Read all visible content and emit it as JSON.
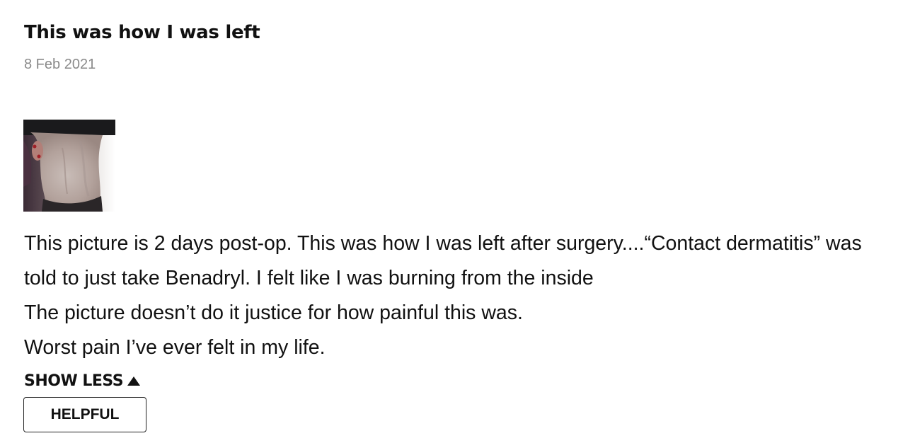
{
  "review": {
    "title": "This was how I was left",
    "date": "8 Feb 2021",
    "body_lines": [
      "This picture is 2 days post-op. This was how I was left after surgery....“Contact dermatitis” was",
      "told to just take Benadryl. I felt like I was burning from the inside",
      "The picture doesn’t do it justice for how painful this was.",
      "Worst pain I’ve ever felt in my life."
    ],
    "show_less_label": "SHOW LESS",
    "helpful_label": "HELPFUL"
  },
  "icons": {
    "photo": "review-photo-thumbnail",
    "toggle": "caret-up-icon"
  }
}
